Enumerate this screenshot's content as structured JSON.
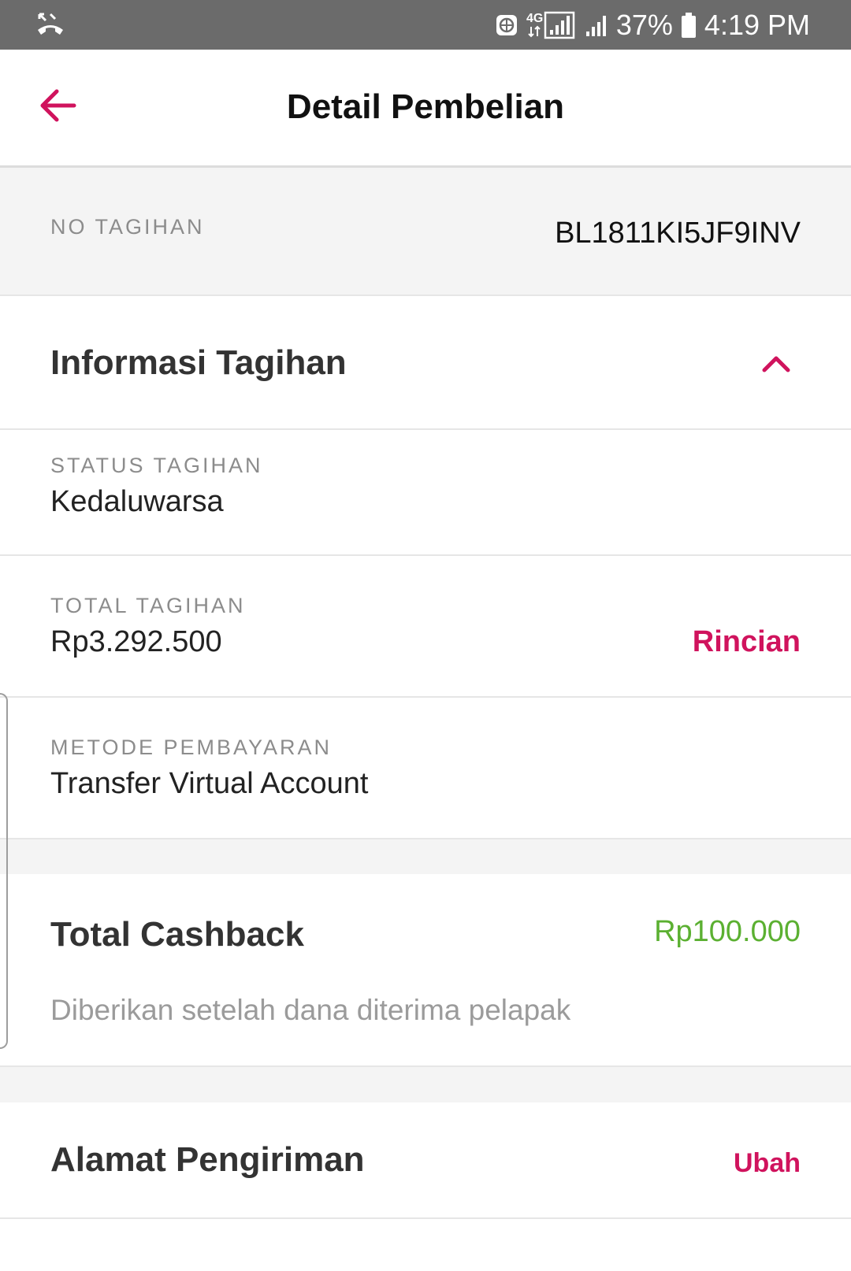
{
  "status_bar": {
    "battery_percent": "37%",
    "time": "4:19 PM",
    "network": "4G",
    "icons": [
      "missed-call-icon",
      "vpn-icon",
      "signal-4g-icon",
      "signal-icon",
      "battery-icon"
    ]
  },
  "header": {
    "title": "Detail Pembelian",
    "back_icon": "arrow-left-icon",
    "accent_color": "#d0135d"
  },
  "invoice": {
    "label": "NO TAGIHAN",
    "value": "BL1811KI5JF9INV"
  },
  "info_section": {
    "title": "Informasi Tagihan",
    "toggle_icon": "chevron-up-icon",
    "rows": [
      {
        "label": "STATUS TAGIHAN",
        "value": "Kedaluwarsa"
      },
      {
        "label": "TOTAL TAGIHAN",
        "value": "Rp3.292.500",
        "action": "Rincian"
      },
      {
        "label": "METODE PEMBAYARAN",
        "value": "Transfer Virtual Account"
      }
    ]
  },
  "cashback": {
    "title": "Total Cashback",
    "amount": "Rp100.000",
    "note": "Diberikan setelah dana diterima pelapak",
    "amount_color": "#5bb031"
  },
  "address": {
    "title": "Alamat Pengiriman",
    "action": "Ubah"
  }
}
